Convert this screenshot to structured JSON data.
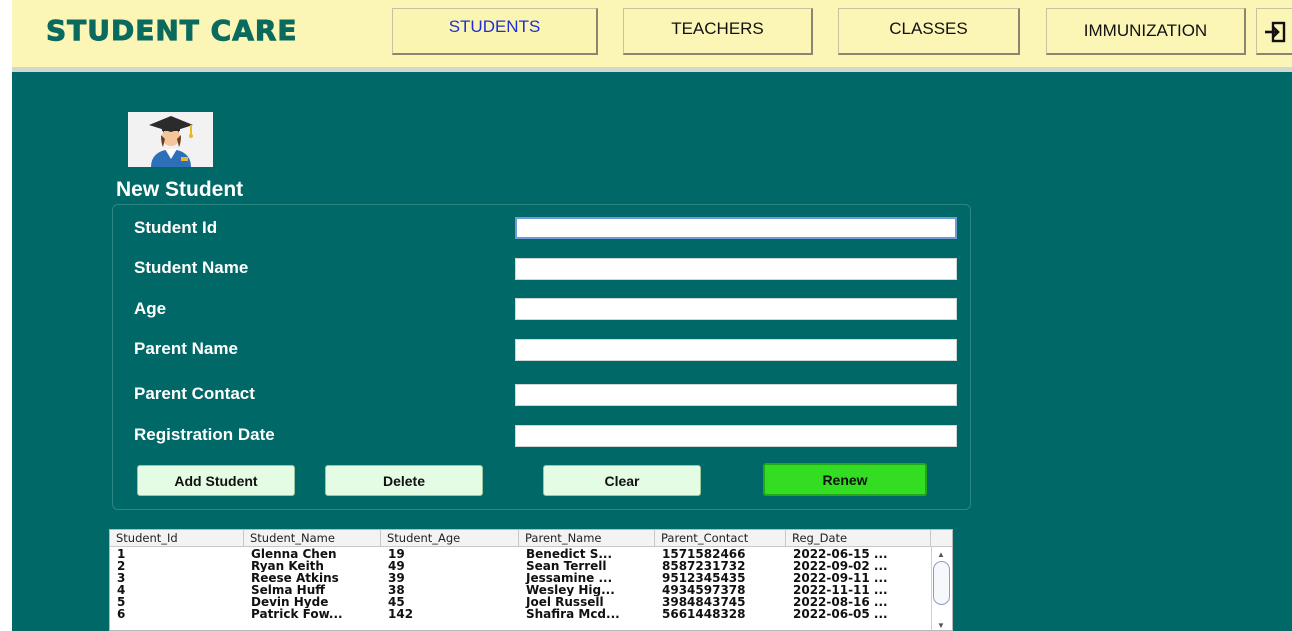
{
  "header": {
    "brand": "STUDENT CARE",
    "nav": {
      "students": "STUDENTS",
      "teachers": "TEACHERS",
      "classes": "CLASSES",
      "immunization": "IMMUNIZATION"
    },
    "logout_icon": "logout-icon"
  },
  "form": {
    "title": "New Student",
    "avatar_icon": "graduate-icon",
    "labels": {
      "student_id": "Student Id",
      "student_name": "Student Name",
      "age": "Age",
      "parent_name": "Parent Name",
      "parent_contact": "Parent Contact",
      "registration_date": "Registration Date"
    },
    "values": {
      "student_id": "",
      "student_name": "",
      "age": "",
      "parent_name": "",
      "parent_contact": "",
      "registration_date": ""
    },
    "buttons": {
      "add": "Add Student",
      "delete": "Delete",
      "clear": "Clear",
      "renew": "Renew"
    }
  },
  "table": {
    "columns": [
      "Student_Id",
      "Student_Name",
      "Student_Age",
      "Parent_Name",
      "Parent_Contact",
      "Reg_Date"
    ],
    "rows": [
      [
        "1",
        "Glenna Chen",
        "19",
        "Benedict S...",
        "1571582466",
        "2022-06-15 ..."
      ],
      [
        "2",
        "Ryan Keith",
        "49",
        "Sean Terrell",
        "8587231732",
        "2022-09-02 ..."
      ],
      [
        "3",
        "Reese Atkins",
        "39",
        "Jessamine ...",
        "9512345435",
        "2022-09-11 ..."
      ],
      [
        "4",
        "Selma Huff",
        "38",
        "Wesley Hig...",
        "4934597378",
        "2022-11-11 ..."
      ],
      [
        "5",
        "Devin Hyde",
        "45",
        "Joel Russell",
        "3984843745",
        "2022-08-16 ..."
      ],
      [
        "6",
        "Patrick Fow...",
        "142",
        "Shafira Mcd...",
        "5661448328",
        "2022-06-05 ..."
      ]
    ]
  },
  "colors": {
    "background": "#006866",
    "header": "#fcf6b6",
    "brand": "#0b6a5e",
    "active_nav": "#1f2ed6",
    "renew_button": "#33dd22",
    "button": "#e4fbe4"
  }
}
